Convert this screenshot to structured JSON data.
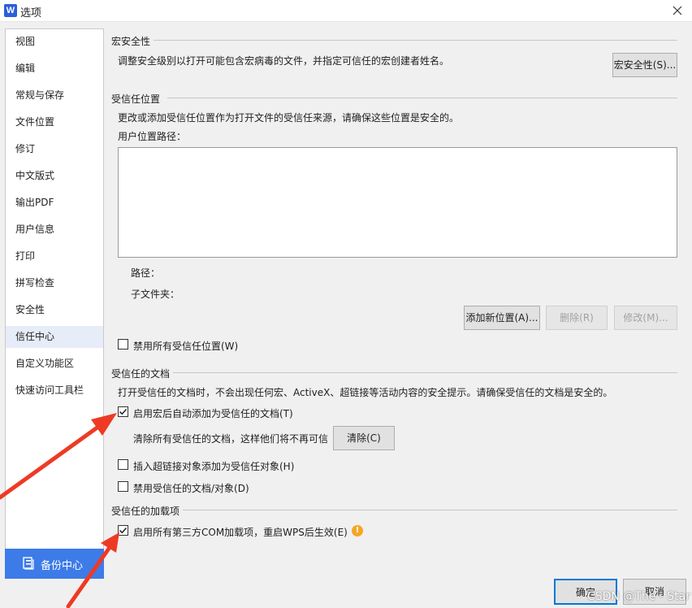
{
  "window": {
    "title": "选项",
    "app_icon_letter": "W"
  },
  "sidebar": {
    "items": [
      {
        "label": "视图"
      },
      {
        "label": "编辑"
      },
      {
        "label": "常规与保存"
      },
      {
        "label": "文件位置"
      },
      {
        "label": "修订"
      },
      {
        "label": "中文版式"
      },
      {
        "label": "输出PDF"
      },
      {
        "label": "用户信息"
      },
      {
        "label": "打印"
      },
      {
        "label": "拼写检查"
      },
      {
        "label": "安全性"
      },
      {
        "label": "信任中心",
        "active": true
      },
      {
        "label": "自定义功能区"
      },
      {
        "label": "快速访问工具栏"
      }
    ],
    "backup_label": "备份中心"
  },
  "macro": {
    "section_title": "宏安全性",
    "description": "调整安全级别以打开可能包含宏病毒的文件，并指定可信任的宏创建者姓名。",
    "button_label": "宏安全性(S)..."
  },
  "locations": {
    "section_title": "受信任位置",
    "description": "更改或添加受信任位置作为打开文件的受信任来源，请确保这些位置是安全的。",
    "list_label": "用户位置路径：",
    "path_label": "路径：",
    "subfolder_label": "子文件夹：",
    "add_button": "添加新位置(A)...",
    "delete_button": "删除(R)",
    "modify_button": "修改(M)...",
    "disable_all_label": "禁用所有受信任位置(W)",
    "disable_all_checked": false
  },
  "documents": {
    "section_title": "受信任的文档",
    "description": "打开受信任的文档时，不会出现任何宏、ActiveX、超链接等活动内容的安全提示。请确保受信任的文档是安全的。",
    "auto_add_label": "启用宏后自动添加为受信任的文档(T)",
    "auto_add_checked": true,
    "clear_text": "清除所有受信任的文档，这样他们将不再可信",
    "clear_button": "清除(C)",
    "hyperlink_label": "插入超链接对象添加为受信任对象(H)",
    "hyperlink_checked": false,
    "disable_docs_label": "禁用受信任的文档/对象(D)",
    "disable_docs_checked": false
  },
  "addins": {
    "section_title": "受信任的加载项",
    "com_label": "启用所有第三方COM加载项，重启WPS后生效(E)",
    "com_checked": true,
    "warning_glyph": "!"
  },
  "footer": {
    "ok_label": "确定",
    "cancel_label": "取消"
  },
  "watermark": "CSDN @The - Star",
  "colors": {
    "accent": "#3d7be8",
    "arrow": "#ee3a24",
    "warning": "#f5a623"
  },
  "icons": {
    "close": "close-icon",
    "app": "wps-writer-icon",
    "backup": "backup-icon",
    "check": "check-icon",
    "warning": "warning-icon"
  }
}
